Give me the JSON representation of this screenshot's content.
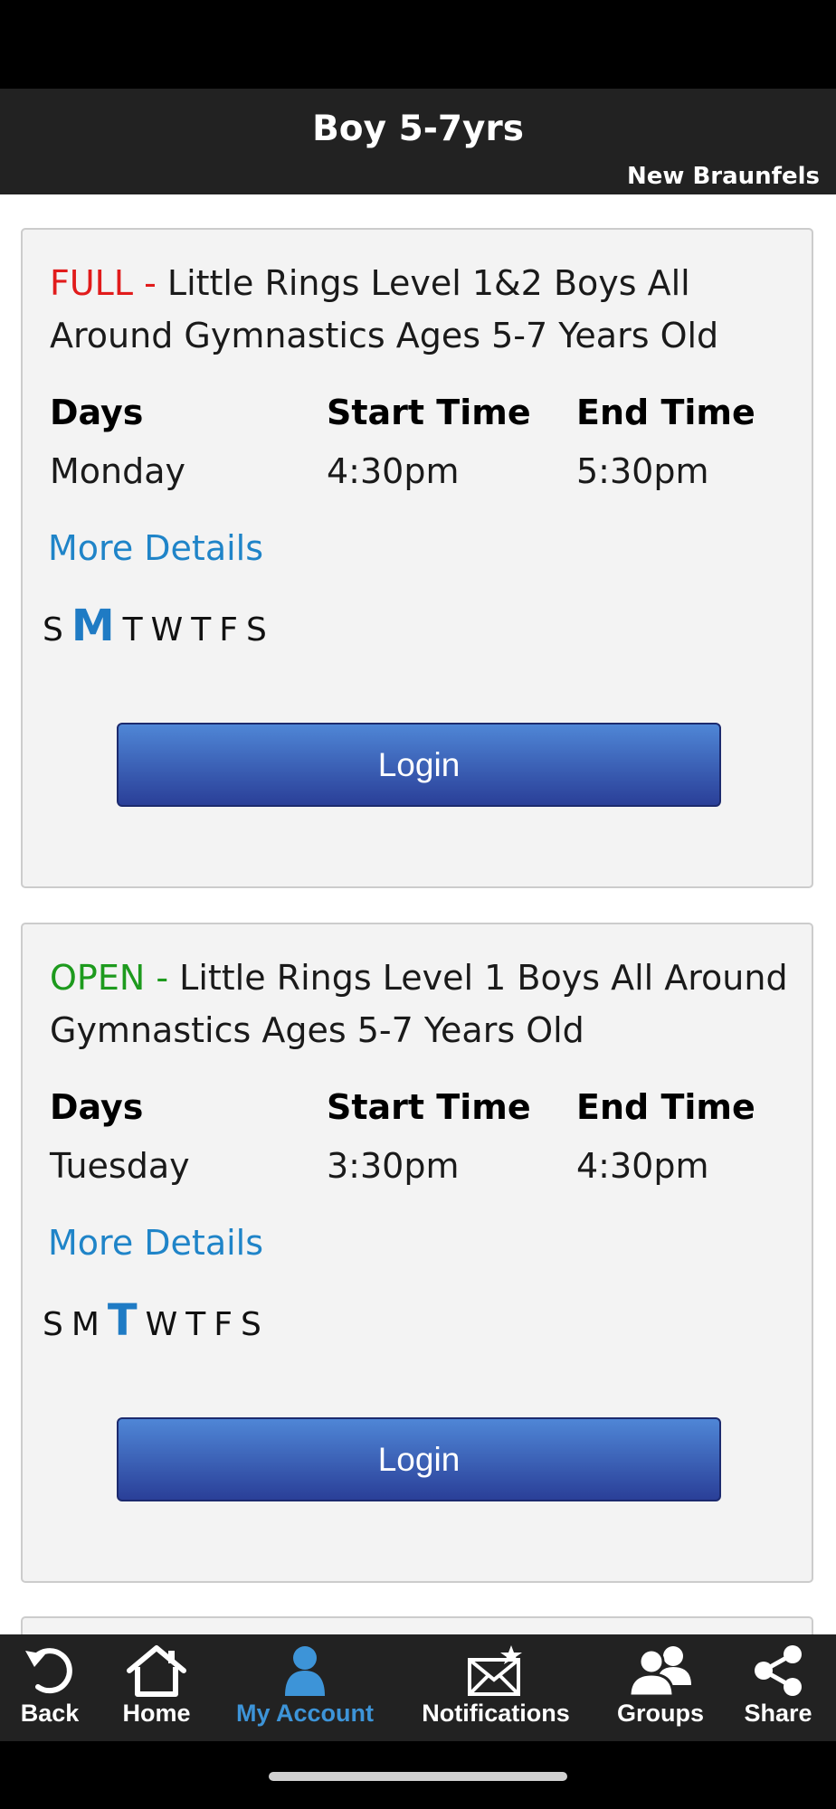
{
  "header": {
    "title": "Boy 5-7yrs",
    "location": "New Braunfels"
  },
  "classes": [
    {
      "status": "FULL -",
      "name": "Little Rings Level 1&2 Boys All Around Gymnastics Ages 5-7 Years Old",
      "days_label": "Days",
      "start_label": "Start Time",
      "end_label": "End Time",
      "day": "Monday",
      "start": "4:30pm",
      "end": "5:30pm",
      "more": "More Details",
      "weekdays": [
        "S",
        "M",
        "T",
        "W",
        "T",
        "F",
        "S"
      ],
      "active_day_index": 1,
      "login": "Login"
    },
    {
      "status": "OPEN -",
      "name": "Little Rings Level 1 Boys All Around Gymnastics Ages 5-7 Years Old",
      "days_label": "Days",
      "start_label": "Start Time",
      "end_label": "End Time",
      "day": "Tuesday",
      "start": "3:30pm",
      "end": "4:30pm",
      "more": "More Details",
      "weekdays": [
        "S",
        "M",
        "T",
        "W",
        "T",
        "F",
        "S"
      ],
      "active_day_index": 2,
      "login": "Login"
    }
  ],
  "colors": {
    "full": "#e11b1b",
    "open": "#1d9a1d",
    "link": "#1f84c8",
    "active_tab": "#3d94d8"
  },
  "tabbar": {
    "back": {
      "label": "Back",
      "icon": "back-arrow-icon"
    },
    "home": {
      "label": "Home",
      "icon": "home-icon"
    },
    "account": {
      "label": "My Account",
      "icon": "person-icon"
    },
    "notifications": {
      "label": "Notifications",
      "icon": "envelope-star-icon"
    },
    "groups": {
      "label": "Groups",
      "icon": "people-icon"
    },
    "share": {
      "label": "Share",
      "icon": "share-icon"
    }
  }
}
